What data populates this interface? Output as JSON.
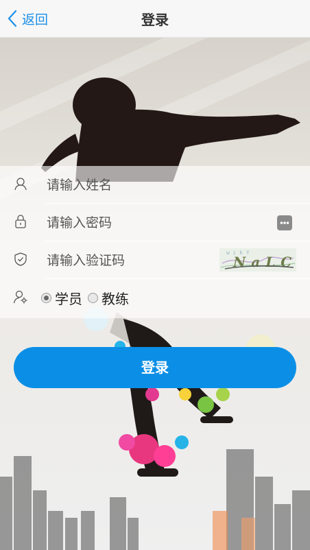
{
  "header": {
    "back_label": "返回",
    "title": "登录"
  },
  "form": {
    "name_placeholder": "请输入姓名",
    "password_placeholder": "请输入密码",
    "captcha_placeholder": "请输入验证码",
    "captcha_text": "NaLC",
    "roles": [
      {
        "label": "学员",
        "selected": true
      },
      {
        "label": "教练",
        "selected": false
      }
    ]
  },
  "login_button": "登录",
  "colors": {
    "accent": "#0b8fe6",
    "back_link": "#1a8fe8"
  }
}
